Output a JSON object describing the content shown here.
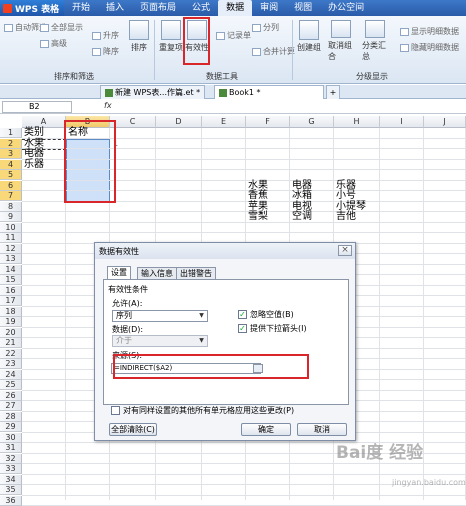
{
  "app": {
    "logo_text": "WPS 表格",
    "menu": [
      "开始",
      "插入",
      "页面布局",
      "公式",
      "数据",
      "审阅",
      "视图",
      "办公空间"
    ],
    "active_menu": "数据"
  },
  "ribbon": {
    "small_left": [
      "自动筛选",
      "全部显示",
      "高级",
      "升序",
      "降序"
    ],
    "sort": "排序",
    "dedupe": "重复项",
    "validity": "有效性",
    "consolidate": "合并计算",
    "split": "分列",
    "record": "记录单",
    "group_create": "创建组",
    "group_cancel": "取消组合",
    "subtotal": "分类汇总",
    "show_detail": "显示明细数据",
    "hide_detail": "隐藏明细数据",
    "groups": [
      "排序和筛选",
      "数据工具",
      "分级显示"
    ]
  },
  "doc_tabs": {
    "tab1": "新建 WPS表...作篇.et *",
    "tab2": "Book1 *",
    "add": "+"
  },
  "formula_bar": {
    "name_box": "B2",
    "fx": "fx"
  },
  "grid": {
    "columns": [
      "A",
      "B",
      "C",
      "D",
      "E",
      "F",
      "G",
      "H",
      "I",
      "J"
    ],
    "rows": [
      "1",
      "2",
      "3",
      "4",
      "5",
      "6",
      "7",
      "8",
      "9",
      "10",
      "11",
      "12",
      "13",
      "14",
      "15",
      "16",
      "17",
      "18",
      "19",
      "20",
      "21",
      "22",
      "23",
      "24",
      "25",
      "26",
      "27",
      "28",
      "29",
      "30",
      "31",
      "32",
      "33",
      "34",
      "35",
      "36"
    ],
    "cells": {
      "A1": "类别",
      "B1": "名称",
      "A2": "水果",
      "A3": "电器",
      "A4": "乐器",
      "F6": "水果",
      "G6": "电器",
      "H6": "乐器",
      "F7": "香蕉",
      "G7": "冰箱",
      "H7": "小号",
      "F8": "苹果",
      "G8": "电视",
      "H8": "小提琴",
      "F9": "雪梨",
      "G9": "空调",
      "H9": "吉他"
    },
    "note_marker": "1"
  },
  "dialog": {
    "title": "数据有效性",
    "close": "×",
    "tabs": [
      "设置",
      "输入信息",
      "出错警告"
    ],
    "active_tab": "设置",
    "section": "有效性条件",
    "allow_label": "允许(A):",
    "allow_value": "序列",
    "data_label": "数据(D):",
    "data_value": "介于",
    "ignore_blank": "忽略空值(B)",
    "in_cell_dropdown": "提供下拉箭头(I)",
    "source_label": "来源(S):",
    "source_value": "=INDIRECT($A2)",
    "apply_all": "对有同样设置的其他所有单元格应用这些更改(P)",
    "clear_all": "全部清除(C)",
    "ok": "确定",
    "cancel": "取消"
  },
  "watermark": {
    "text": "Bai度 经验",
    "sub": "jingyan.baidu.com"
  },
  "colors": {
    "highlight_red": "#d9262a",
    "selection_blue": "#cfe1f8",
    "menu_blue": "#2a5ba8"
  }
}
